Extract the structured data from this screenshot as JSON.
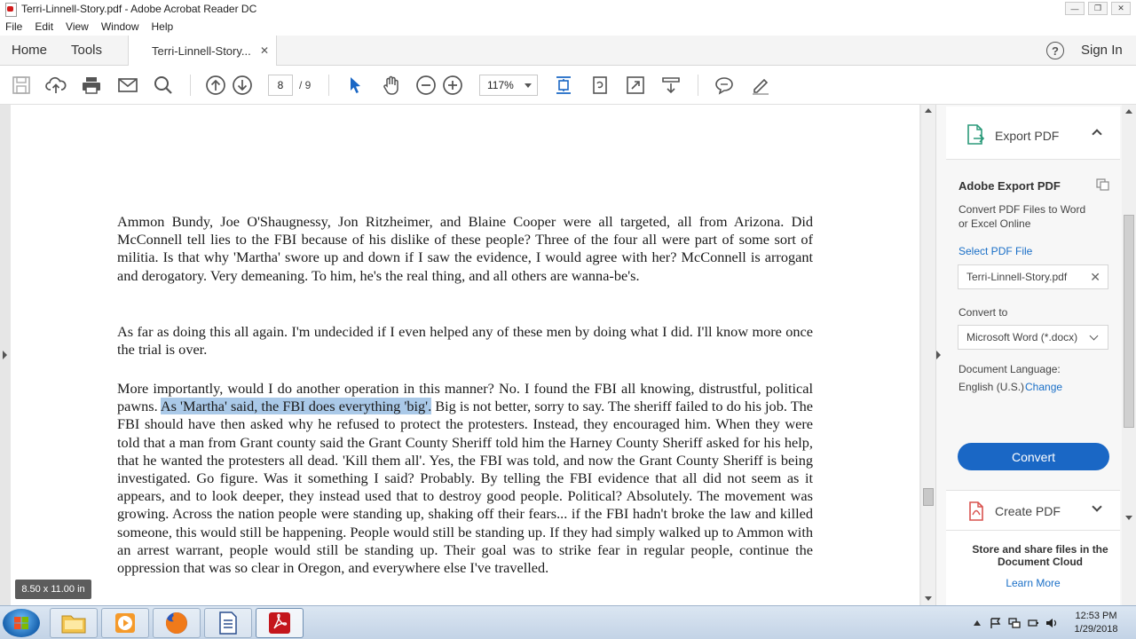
{
  "window": {
    "title": "Terri-Linnell-Story.pdf - Adobe Acrobat Reader DC"
  },
  "menu": [
    "File",
    "Edit",
    "View",
    "Window",
    "Help"
  ],
  "tabs": {
    "home": "Home",
    "tools": "Tools",
    "document": "Terri-Linnell-Story...",
    "sign_in": "Sign In"
  },
  "toolbar": {
    "current_page": "8",
    "total_pages": "/ 9",
    "zoom": "117%"
  },
  "document": {
    "paragraphs": [
      "Ammon Bundy, Joe O'Shaugnessy, Jon Ritzheimer, and Blaine Cooper were all targeted, all from Arizona. Did McConnell tell lies to the FBI because of his dislike of these people? Three of the four all were part of some sort of militia.  Is that why 'Martha' swore up and down if I saw the evidence, I would agree with her? McConnell is arrogant and derogatory. Very demeaning. To him, he's the real thing, and all others are wanna-be's.",
      "As far as doing this all again. I'm undecided if I even helped any of these men by doing what I did. I'll know more once the trial is over."
    ],
    "p3_before": "More importantly, would I do another operation in this manner? No. I found the FBI all knowing, distrustful, political pawns. ",
    "p3_highlight": "As 'Martha' said, the FBI does everything 'big'.",
    "p3_after": " Big is not better, sorry to say. The sheriff failed to do his job. The FBI should have then asked why he refused to protect the protesters. Instead, they encouraged him. When they were told that a man from Grant county said the Grant County Sheriff told him the Harney County Sheriff asked for his help, that he wanted the protesters all dead. 'Kill them all'. Yes, the FBI was told, and now the Grant County Sheriff is being investigated. Go figure. Was it something I said? Probably. By telling the FBI evidence that all did not seem as it appears, and to look deeper, they instead used that to destroy good people. Political? Absolutely. The movement was growing. Across the nation people were standing up, shaking off their fears... if the FBI hadn't broke the law and killed someone, this would still be happening. People would still be standing up. If they had simply walked up to Ammon with an arrest warrant, people would still be standing up. Their goal was to strike fear in regular people, continue the oppression that was so clear in Oregon, and everywhere else I've travelled.",
    "page_size": "8.50 x 11.00 in"
  },
  "panel": {
    "export_label": "Export PDF",
    "title": "Adobe Export PDF",
    "desc": "Convert PDF Files to Word or Excel Online",
    "select_label": "Select PDF File",
    "file_name": "Terri-Linnell-Story.pdf",
    "convert_to_label": "Convert to",
    "convert_to_value": "Microsoft Word (*.docx)",
    "language_label": "Document Language:",
    "language_value": "English (U.S.)",
    "change_link": "Change",
    "convert_button": "Convert",
    "create_label": "Create PDF",
    "promo_text": "Store and share files in the Document Cloud",
    "learn_more": "Learn More"
  },
  "taskbar": {
    "time": "12:53 PM",
    "date": "1/29/2018"
  },
  "colors": {
    "accent": "#1a67c5",
    "highlight": "#aac9e8",
    "selected_tool": "#1a67c5"
  }
}
